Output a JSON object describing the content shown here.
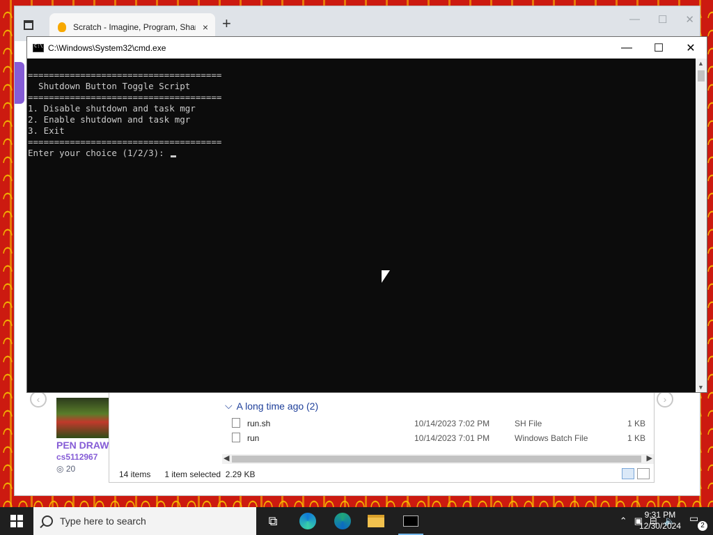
{
  "browser": {
    "tab_title": "Scratch - Imagine, Program, Share",
    "tab_close": "×",
    "new_tab": "+",
    "minimize": "—",
    "maximize": "☐",
    "close": "✕"
  },
  "scratch": {
    "project_title": "PEN DRAW",
    "project_user": "cs5112967",
    "project_views": "20"
  },
  "explorer": {
    "group_label": "A long time ago (2)",
    "files": [
      {
        "name": "run.sh",
        "date": "10/14/2023 7:02 PM",
        "type": "SH File",
        "size": "1 KB"
      },
      {
        "name": "run",
        "date": "10/14/2023 7:01 PM",
        "type": "Windows Batch File",
        "size": "1 KB"
      }
    ],
    "status_items": "14 items",
    "status_selected": "1 item selected",
    "status_size": "2.29 KB"
  },
  "cmd": {
    "title": "C:\\Windows\\System32\\cmd.exe",
    "minimize": "—",
    "maximize": "☐",
    "close": "✕",
    "lines": [
      "=====================================",
      "  Shutdown Button Toggle Script",
      "=====================================",
      "1. Disable shutdown and task mgr",
      "2. Enable shutdown and task mgr",
      "3. Exit",
      "=====================================",
      "Enter your choice (1/2/3): "
    ]
  },
  "taskbar": {
    "search_placeholder": "Type here to search",
    "time": "9:31 PM",
    "date": "12/30/2024",
    "notification_count": "2",
    "icons": [
      "task-view-icon",
      "edge-icon",
      "edge-beta-icon",
      "file-explorer-icon",
      "terminal-icon"
    ]
  },
  "colors": {
    "wallpaper_red": "#cc1a10",
    "wallpaper_yellow": "#f7c300",
    "scratch_purple": "#855cd6",
    "console_bg": "#0c0c0c",
    "console_fg": "#cccccc",
    "taskbar_bg": "#1f1f1f"
  }
}
